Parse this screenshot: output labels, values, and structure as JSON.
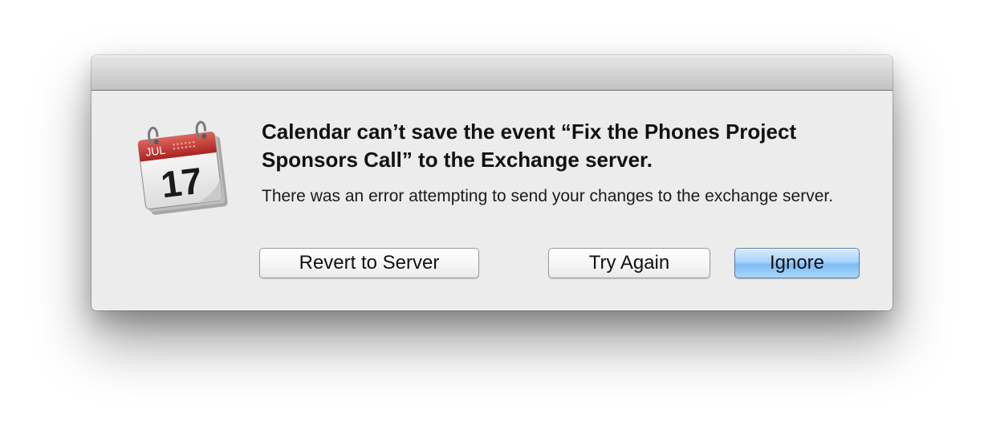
{
  "dialog": {
    "app_icon": {
      "name": "calendar-icon",
      "month": "JUL",
      "day": "17"
    },
    "headline": "Calendar can’t save the event “Fix the Phones Project Sponsors Call” to the Exchange server.",
    "message": "There was an error attempting to send your changes to the exchange server.",
    "buttons": {
      "revert": "Revert to Server",
      "retry": "Try Again",
      "ignore": "Ignore"
    },
    "default_button": "ignore"
  },
  "colors": {
    "default_button": "#8ec5f7",
    "calendar_header": "#c8403a"
  }
}
